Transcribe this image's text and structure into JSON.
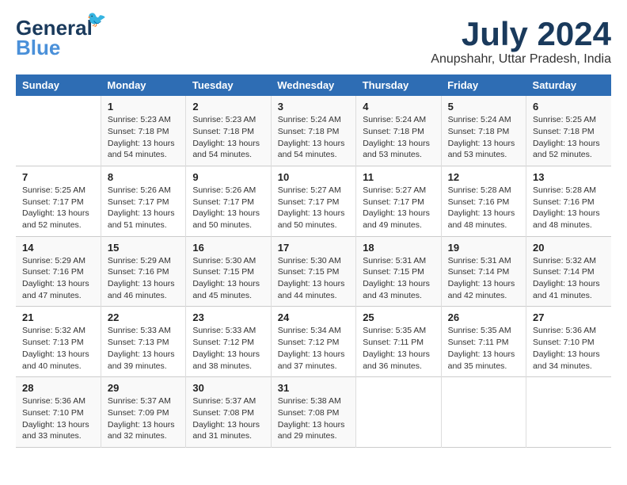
{
  "logo": {
    "line1": "General",
    "line2": "Blue"
  },
  "title": "July 2024",
  "location": "Anupshahr, Uttar Pradesh, India",
  "headers": [
    "Sunday",
    "Monday",
    "Tuesday",
    "Wednesday",
    "Thursday",
    "Friday",
    "Saturday"
  ],
  "weeks": [
    [
      {
        "day": "",
        "info": ""
      },
      {
        "day": "1",
        "info": "Sunrise: 5:23 AM\nSunset: 7:18 PM\nDaylight: 13 hours\nand 54 minutes."
      },
      {
        "day": "2",
        "info": "Sunrise: 5:23 AM\nSunset: 7:18 PM\nDaylight: 13 hours\nand 54 minutes."
      },
      {
        "day": "3",
        "info": "Sunrise: 5:24 AM\nSunset: 7:18 PM\nDaylight: 13 hours\nand 54 minutes."
      },
      {
        "day": "4",
        "info": "Sunrise: 5:24 AM\nSunset: 7:18 PM\nDaylight: 13 hours\nand 53 minutes."
      },
      {
        "day": "5",
        "info": "Sunrise: 5:24 AM\nSunset: 7:18 PM\nDaylight: 13 hours\nand 53 minutes."
      },
      {
        "day": "6",
        "info": "Sunrise: 5:25 AM\nSunset: 7:18 PM\nDaylight: 13 hours\nand 52 minutes."
      }
    ],
    [
      {
        "day": "7",
        "info": "Sunrise: 5:25 AM\nSunset: 7:17 PM\nDaylight: 13 hours\nand 52 minutes."
      },
      {
        "day": "8",
        "info": "Sunrise: 5:26 AM\nSunset: 7:17 PM\nDaylight: 13 hours\nand 51 minutes."
      },
      {
        "day": "9",
        "info": "Sunrise: 5:26 AM\nSunset: 7:17 PM\nDaylight: 13 hours\nand 50 minutes."
      },
      {
        "day": "10",
        "info": "Sunrise: 5:27 AM\nSunset: 7:17 PM\nDaylight: 13 hours\nand 50 minutes."
      },
      {
        "day": "11",
        "info": "Sunrise: 5:27 AM\nSunset: 7:17 PM\nDaylight: 13 hours\nand 49 minutes."
      },
      {
        "day": "12",
        "info": "Sunrise: 5:28 AM\nSunset: 7:16 PM\nDaylight: 13 hours\nand 48 minutes."
      },
      {
        "day": "13",
        "info": "Sunrise: 5:28 AM\nSunset: 7:16 PM\nDaylight: 13 hours\nand 48 minutes."
      }
    ],
    [
      {
        "day": "14",
        "info": "Sunrise: 5:29 AM\nSunset: 7:16 PM\nDaylight: 13 hours\nand 47 minutes."
      },
      {
        "day": "15",
        "info": "Sunrise: 5:29 AM\nSunset: 7:16 PM\nDaylight: 13 hours\nand 46 minutes."
      },
      {
        "day": "16",
        "info": "Sunrise: 5:30 AM\nSunset: 7:15 PM\nDaylight: 13 hours\nand 45 minutes."
      },
      {
        "day": "17",
        "info": "Sunrise: 5:30 AM\nSunset: 7:15 PM\nDaylight: 13 hours\nand 44 minutes."
      },
      {
        "day": "18",
        "info": "Sunrise: 5:31 AM\nSunset: 7:15 PM\nDaylight: 13 hours\nand 43 minutes."
      },
      {
        "day": "19",
        "info": "Sunrise: 5:31 AM\nSunset: 7:14 PM\nDaylight: 13 hours\nand 42 minutes."
      },
      {
        "day": "20",
        "info": "Sunrise: 5:32 AM\nSunset: 7:14 PM\nDaylight: 13 hours\nand 41 minutes."
      }
    ],
    [
      {
        "day": "21",
        "info": "Sunrise: 5:32 AM\nSunset: 7:13 PM\nDaylight: 13 hours\nand 40 minutes."
      },
      {
        "day": "22",
        "info": "Sunrise: 5:33 AM\nSunset: 7:13 PM\nDaylight: 13 hours\nand 39 minutes."
      },
      {
        "day": "23",
        "info": "Sunrise: 5:33 AM\nSunset: 7:12 PM\nDaylight: 13 hours\nand 38 minutes."
      },
      {
        "day": "24",
        "info": "Sunrise: 5:34 AM\nSunset: 7:12 PM\nDaylight: 13 hours\nand 37 minutes."
      },
      {
        "day": "25",
        "info": "Sunrise: 5:35 AM\nSunset: 7:11 PM\nDaylight: 13 hours\nand 36 minutes."
      },
      {
        "day": "26",
        "info": "Sunrise: 5:35 AM\nSunset: 7:11 PM\nDaylight: 13 hours\nand 35 minutes."
      },
      {
        "day": "27",
        "info": "Sunrise: 5:36 AM\nSunset: 7:10 PM\nDaylight: 13 hours\nand 34 minutes."
      }
    ],
    [
      {
        "day": "28",
        "info": "Sunrise: 5:36 AM\nSunset: 7:10 PM\nDaylight: 13 hours\nand 33 minutes."
      },
      {
        "day": "29",
        "info": "Sunrise: 5:37 AM\nSunset: 7:09 PM\nDaylight: 13 hours\nand 32 minutes."
      },
      {
        "day": "30",
        "info": "Sunrise: 5:37 AM\nSunset: 7:08 PM\nDaylight: 13 hours\nand 31 minutes."
      },
      {
        "day": "31",
        "info": "Sunrise: 5:38 AM\nSunset: 7:08 PM\nDaylight: 13 hours\nand 29 minutes."
      },
      {
        "day": "",
        "info": ""
      },
      {
        "day": "",
        "info": ""
      },
      {
        "day": "",
        "info": ""
      }
    ]
  ]
}
